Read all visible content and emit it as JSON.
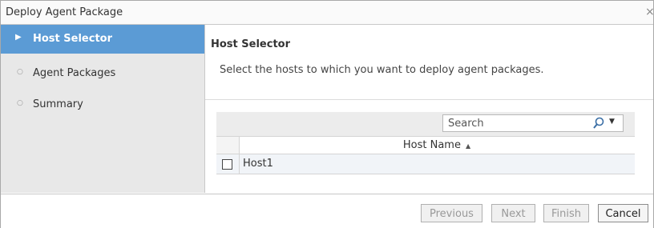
{
  "dialog": {
    "title": "Deploy Agent Package",
    "close_glyph": "×"
  },
  "sidebar": {
    "items": [
      {
        "label": "Host Selector",
        "active": true
      },
      {
        "label": "Agent Packages",
        "active": false
      },
      {
        "label": "Summary",
        "active": false
      }
    ]
  },
  "main": {
    "heading": "Host Selector",
    "description": "Select the hosts to which you want to deploy agent packages.",
    "search": {
      "placeholder": "Search"
    },
    "table": {
      "columns": [
        "Host Name"
      ],
      "sort": "ascending",
      "rows": [
        {
          "host": "Host1",
          "checked": false
        }
      ]
    }
  },
  "footer": {
    "previous_label": "Previous",
    "next_label": "Next",
    "finish_label": "Finish",
    "cancel_label": "Cancel"
  },
  "colors": {
    "active_nav": "#5b9bd5",
    "sidebar_bg": "#e8e8e8"
  },
  "icons": [
    "close-icon",
    "triangle-right-icon",
    "bullet-icon",
    "magnifier-icon",
    "sort-ascending-icon",
    "dropdown-caret-icon",
    "checkbox-icon"
  ]
}
